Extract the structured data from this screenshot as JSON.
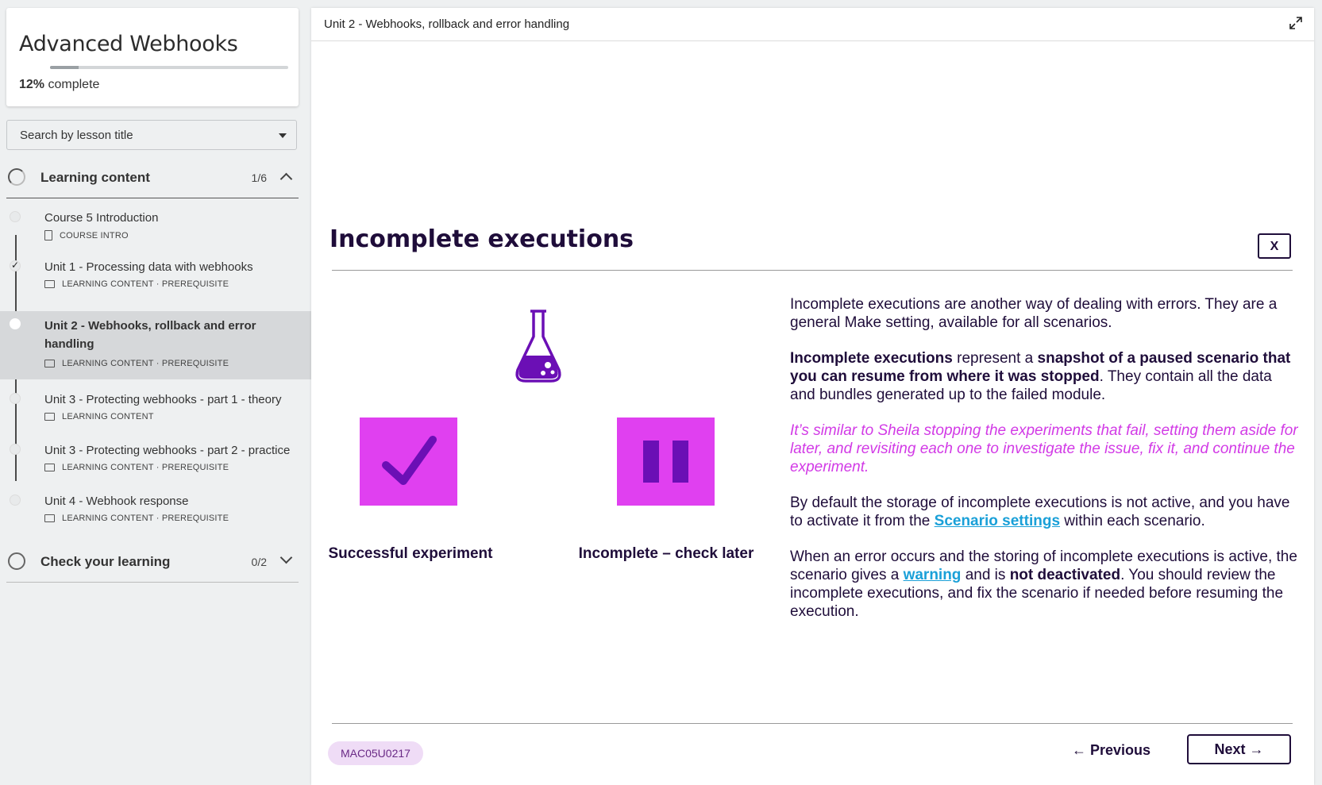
{
  "sidebar": {
    "course_title": "Advanced Webhooks",
    "progress_percent": "12%",
    "progress_suffix": "complete",
    "progress_value": 0.12,
    "search_placeholder": "Search by lesson title",
    "sections": [
      {
        "title": "Learning content",
        "count": "1/6",
        "state": "expanded"
      },
      {
        "title": "Check your learning",
        "count": "0/2",
        "state": "collapsed"
      }
    ],
    "lessons": [
      {
        "title": "Course 5 Introduction",
        "meta": "COURSE INTRO",
        "icon": "document-icon"
      },
      {
        "title": "Unit 1 - Processing data with webhooks",
        "meta": "LEARNING CONTENT · PREREQUISITE",
        "icon": "slides-icon",
        "completed": true
      },
      {
        "title": "Unit 2 - Webhooks, rollback and error handling",
        "meta": "LEARNING CONTENT · PREREQUISITE",
        "icon": "slides-icon",
        "active": true
      },
      {
        "title": "Unit 3 - Protecting webhooks - part 1 - theory",
        "meta": "LEARNING CONTENT",
        "icon": "slides-icon"
      },
      {
        "title": "Unit 3 - Protecting webhooks - part 2 - practice",
        "meta": "LEARNING CONTENT · PREREQUISITE",
        "icon": "slides-icon"
      },
      {
        "title": "Unit 4 - Webhook response",
        "meta": "LEARNING CONTENT · PREREQUISITE",
        "icon": "slides-icon"
      }
    ]
  },
  "main": {
    "topbar_title": "Unit 2 - Webhooks, rollback and error handling",
    "heading": "Incomplete executions",
    "close_label": "X",
    "left_label": "Successful experiment",
    "right_label": "Incomplete – check later",
    "p1": "Incomplete executions are another way of dealing with errors. They are a general Make setting, available for all scenarios.",
    "p2_b1": "Incomplete executions",
    "p2_t1": " represent a ",
    "p2_b2": "snapshot of a paused scenario that you can resume from where it was stopped",
    "p2_t2": ". They contain all the data and bundles generated up to the failed module.",
    "p3": "It’s similar to Sheila stopping the experiments that fail, setting them aside for later, and revisiting each one to investigate the issue, fix it, and continue the experiment.",
    "p4_t1": "By default the storage of incomplete executions is not active, and you have to activate it from the ",
    "p4_link": "Scenario settings",
    "p4_t2": " within each scenario.",
    "p5_t1": "When an error occurs and the storing of incomplete executions is active, the scenario gives a ",
    "p5_link": "warning",
    "p5_t2": " and is ",
    "p5_b": "not deactivated",
    "p5_t3": ". You should review the incomplete executions, and fix the scenario if needed before resuming the execution.",
    "code": "MAC05U0217",
    "prev_label": "← Previous",
    "next_label": "Next →"
  },
  "colors": {
    "accent_magenta": "#e040f0",
    "accent_purple": "#6b0fb5",
    "heading_dark": "#1f0d3a",
    "link_blue": "#1aa0d8",
    "italic_pink": "#d23ae6"
  }
}
